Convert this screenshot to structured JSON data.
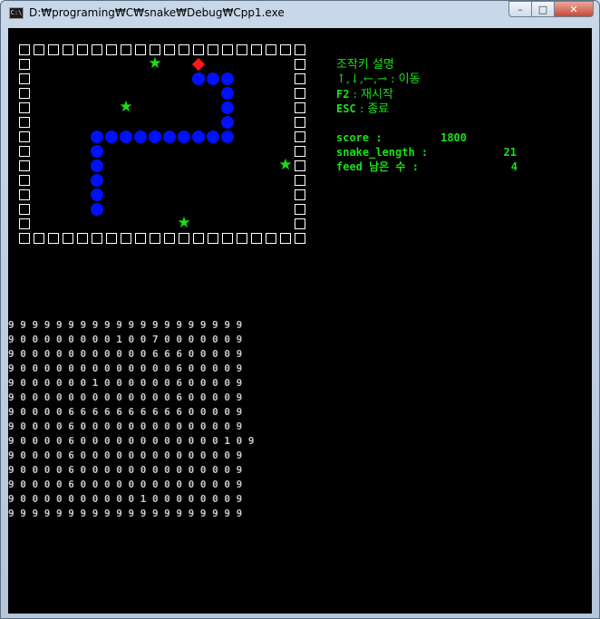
{
  "window": {
    "title": "D:₩programing₩C₩snake₩Debug₩Cpp1.exe",
    "icon": "console-icon",
    "icon_text": "C:\\",
    "buttons": {
      "minimize": "–",
      "maximize": "□",
      "close": "✕"
    }
  },
  "game": {
    "cols": 20,
    "rows": 14,
    "walls": "border",
    "snake_head": [
      12,
      1
    ],
    "snake_body": [
      [
        12,
        2
      ],
      [
        13,
        2
      ],
      [
        14,
        2
      ],
      [
        14,
        3
      ],
      [
        14,
        4
      ],
      [
        14,
        5
      ],
      [
        14,
        6
      ],
      [
        13,
        6
      ],
      [
        12,
        6
      ],
      [
        11,
        6
      ],
      [
        10,
        6
      ],
      [
        9,
        6
      ],
      [
        8,
        6
      ],
      [
        7,
        6
      ],
      [
        6,
        6
      ],
      [
        5,
        6
      ],
      [
        5,
        7
      ],
      [
        5,
        8
      ],
      [
        5,
        9
      ],
      [
        5,
        10
      ],
      [
        5,
        11
      ]
    ],
    "food": [
      [
        9,
        1
      ],
      [
        7,
        4
      ],
      [
        18,
        8
      ],
      [
        11,
        12
      ]
    ],
    "colors": {
      "wall": "#ffffff",
      "snake": "#0010ff",
      "head": "#ff1a1a",
      "food": "#18e018",
      "text": "#18e018",
      "dump": "#c8c8c8"
    },
    "icons": {
      "wall": "wall-square",
      "snake": "snake-circle",
      "head": "head-diamond",
      "food": "star-icon"
    }
  },
  "info": {
    "heading": "조작키 설명",
    "move_keys": "↑,↓,←,→ : 이동",
    "restart_key": "F2",
    "restart_text": " : 재시작",
    "quit_key": "ESC",
    "quit_text": " : 종료",
    "score_label": "score :",
    "score": "1800",
    "length_label": "snake_length :",
    "length": "21",
    "feed_label": "feed 남은 수 :",
    "feed": "4"
  },
  "dump": [
    "9 9 9 9 9 9 9 9 9 9 9 9 9 9 9 9 9 9 9 9",
    "9 0 0 0 0 0 0 0 0 1 0 0 7 0 0 0 0 0 0 9",
    "9 0 0 0 0 0 0 0 0 0 0 0 6 6 6 0 0 0 0 9",
    "9 0 0 0 0 0 0 0 0 0 0 0 0 0 6 0 0 0 0 9",
    "9 0 0 0 0 0 0 1 0 0 0 0 0 0 6 0 0 0 0 9",
    "9 0 0 0 0 0 0 0 0 0 0 0 0 0 6 0 0 0 0 9",
    "9 0 0 0 0 6 6 6 6 6 6 6 6 6 6 0 0 0 0 9",
    "9 0 0 0 0 6 0 0 0 0 0 0 0 0 0 0 0 0 0 9",
    "9 0 0 0 0 6 0 0 0 0 0 0 0 0 0 0 0 0 1 0 9",
    "9 0 0 0 0 6 0 0 0 0 0 0 0 0 0 0 0 0 0 9",
    "9 0 0 0 0 6 0 0 0 0 0 0 0 0 0 0 0 0 0 9",
    "9 0 0 0 0 6 0 0 0 0 0 0 0 0 0 0 0 0 0 9",
    "9 0 0 0 0 0 0 0 0 0 0 1 0 0 0 0 0 0 0 9",
    "9 9 9 9 9 9 9 9 9 9 9 9 9 9 9 9 9 9 9 9"
  ]
}
